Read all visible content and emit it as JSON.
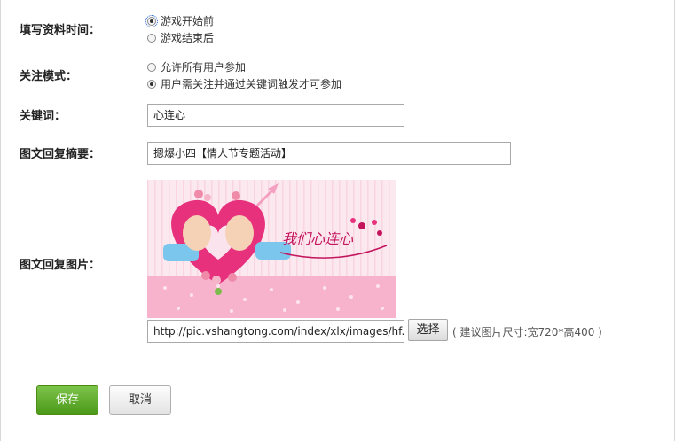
{
  "form": {
    "fill_time": {
      "label": "填写资料时间：",
      "options": [
        "游戏开始前",
        "游戏结束后"
      ],
      "selected_index": 0
    },
    "follow_mode": {
      "label": "关注模式：",
      "options": [
        "允许所有用户参加",
        "用户需关注并通过关键词触发才可参加"
      ],
      "selected_index": 1
    },
    "keyword": {
      "label": "关键词：",
      "value": "心连心"
    },
    "summary": {
      "label": "图文回复摘要：",
      "value": "摁爆小四【情人节专题活动】"
    },
    "picture": {
      "label": "图文回复图片：",
      "image_text": "我们心连心",
      "url_value": "http://pic.vshangtong.com/index/xlx/images/hf.jpg",
      "choose_label": "选择",
      "size_hint": "( 建议图片尺寸:宽720*高400 )"
    }
  },
  "actions": {
    "save_label": "保存",
    "cancel_label": "取消"
  },
  "colors": {
    "save_green": "#5aa827",
    "heart_pink": "#e8317d",
    "banner_pink": "#f8b6cf"
  }
}
